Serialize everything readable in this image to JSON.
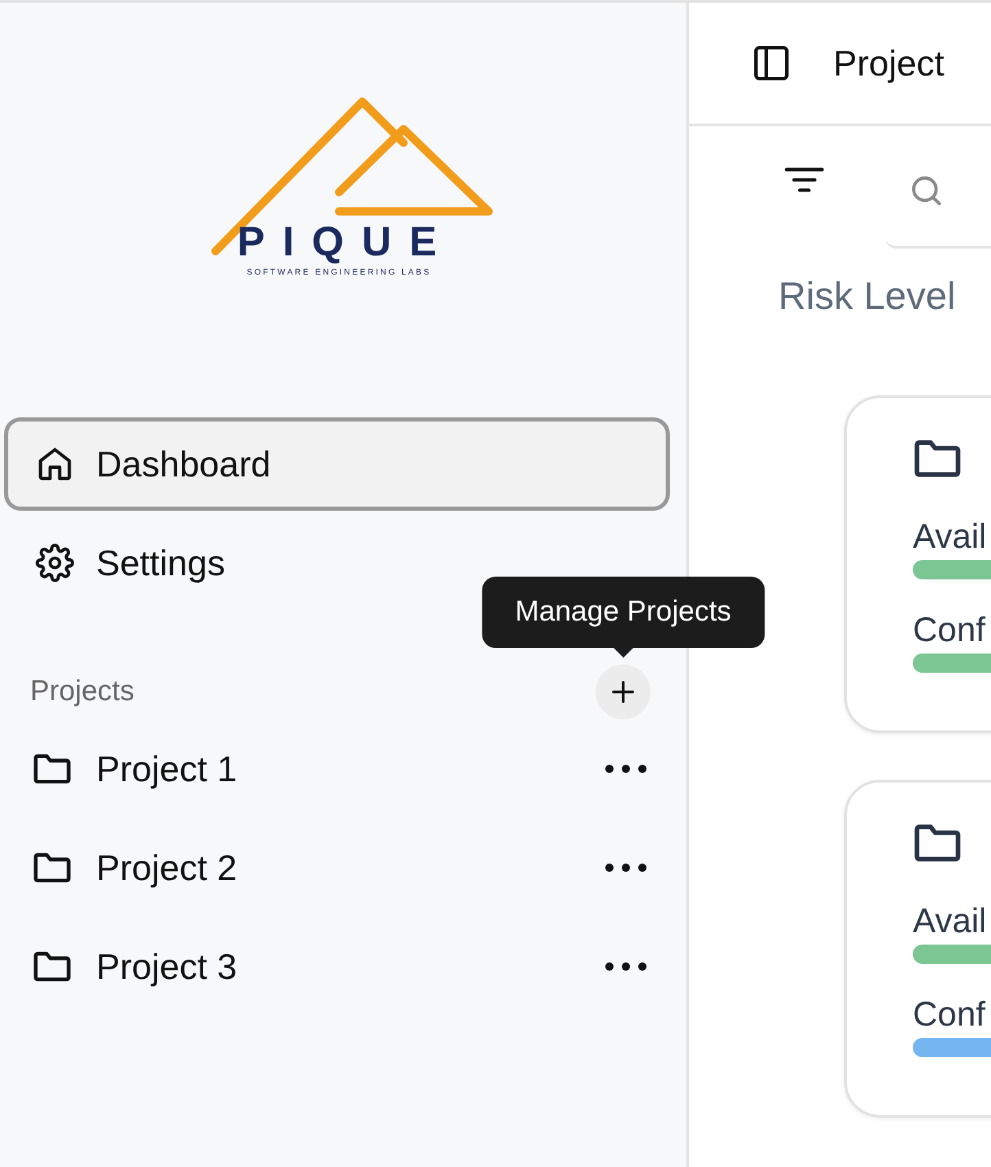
{
  "logo": {
    "wordmark": "PIQUE",
    "tagline": "SOFTWARE ENGINEERING LABS"
  },
  "nav": [
    {
      "label": "Dashboard",
      "selected": true
    },
    {
      "label": "Settings",
      "selected": false
    }
  ],
  "tooltip": "Manage Projects",
  "projects_section": {
    "title": "Projects",
    "items": [
      {
        "label": "Project 1"
      },
      {
        "label": "Project 2"
      },
      {
        "label": "Project 3"
      }
    ]
  },
  "header": {
    "title": "Project"
  },
  "heading": "Risk Level",
  "cards": [
    {
      "metrics": [
        {
          "label": "Avail",
          "color": "#7bc693"
        },
        {
          "label": "Conf",
          "color": "#7bc693"
        }
      ]
    },
    {
      "metrics": [
        {
          "label": "Avail",
          "color": "#7bc693"
        },
        {
          "label": "Conf",
          "color": "#76b6f0"
        }
      ]
    }
  ]
}
